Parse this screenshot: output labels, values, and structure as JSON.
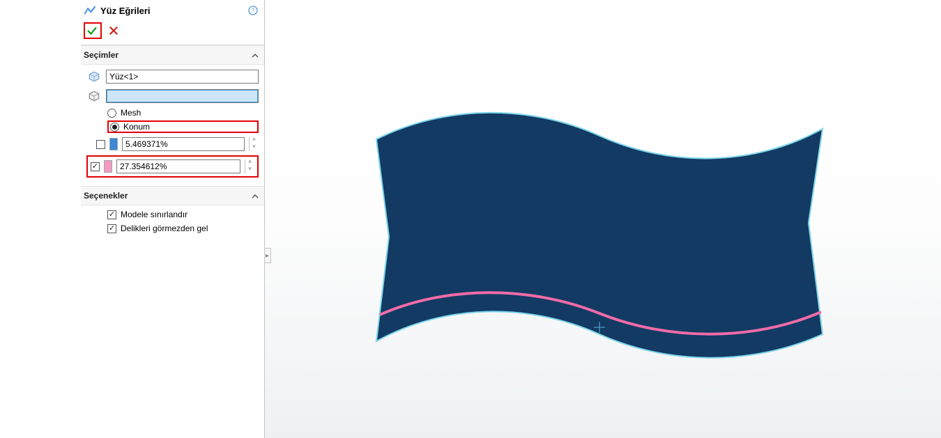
{
  "panel": {
    "title": "Yüz Eğrileri",
    "sections": {
      "selections": {
        "title": "Seçimler",
        "face_value": "Yüz<1>",
        "body_value": "",
        "radio": {
          "mesh": "Mesh",
          "konum": "Konum",
          "selected": "konum"
        },
        "value1": {
          "enabled": false,
          "text": "5.469371%",
          "color": "#3e88d6"
        },
        "value2": {
          "enabled": true,
          "text": "27.354612%",
          "color": "#f49ac1"
        }
      },
      "options": {
        "title": "Seçenekler",
        "constrain": {
          "checked": true,
          "label": "Modele sınırlandır"
        },
        "ignore_holes": {
          "checked": true,
          "label": "Delikleri görmezden gel"
        }
      }
    }
  }
}
